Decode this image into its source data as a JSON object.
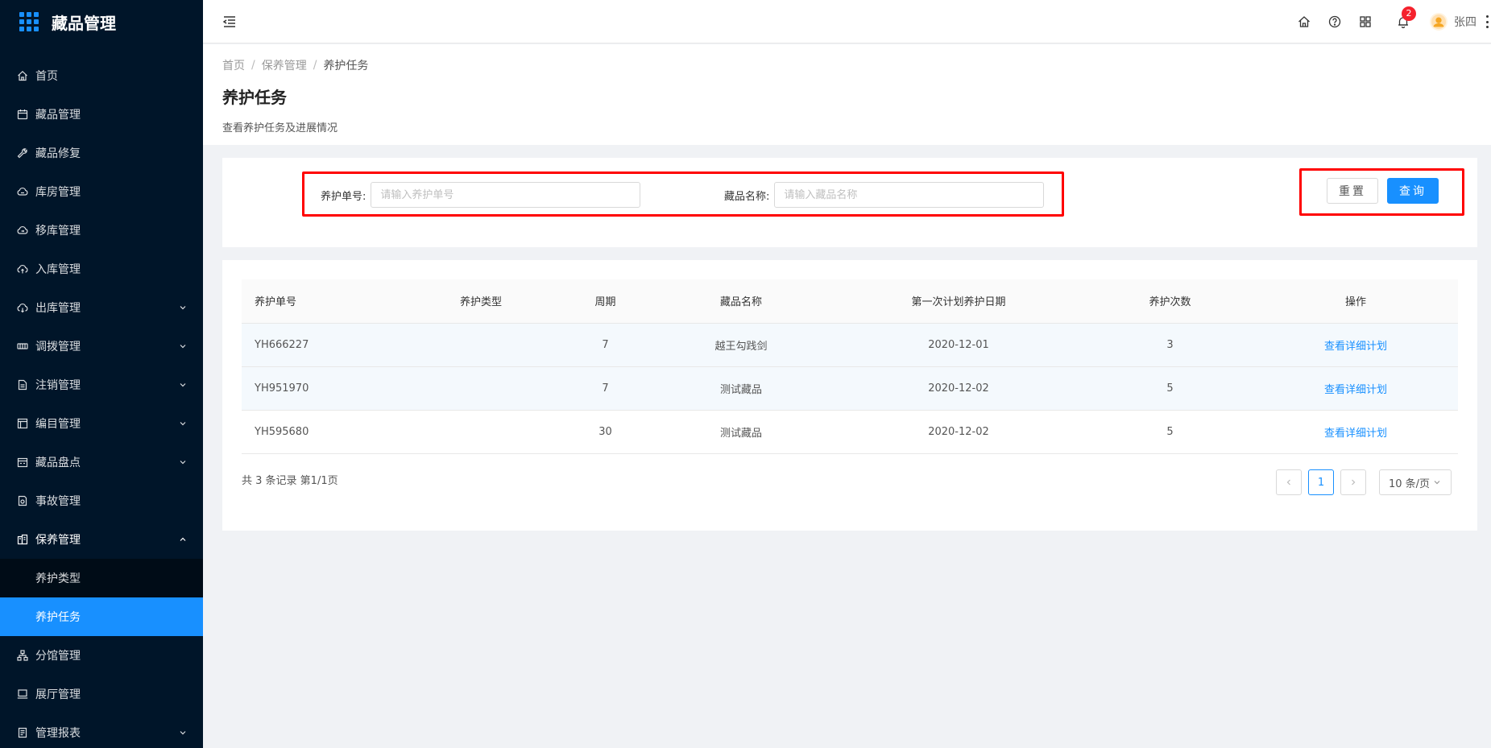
{
  "app": {
    "title": "藏品管理"
  },
  "sidebar": {
    "items": [
      {
        "label": "首页",
        "icon": "home-icon"
      },
      {
        "label": "藏品管理",
        "icon": "calendar-icon"
      },
      {
        "label": "藏品修复",
        "icon": "wrench-icon"
      },
      {
        "label": "库房管理",
        "icon": "cloud-icon"
      },
      {
        "label": "移库管理",
        "icon": "cloud-sync-icon"
      },
      {
        "label": "入库管理",
        "icon": "cloud-upload-icon"
      },
      {
        "label": "出库管理",
        "icon": "cloud-download-icon",
        "expandable": true
      },
      {
        "label": "调拨管理",
        "icon": "transfer-icon",
        "expandable": true
      },
      {
        "label": "注销管理",
        "icon": "file-icon",
        "expandable": true
      },
      {
        "label": "编目管理",
        "icon": "catalog-icon",
        "expandable": true
      },
      {
        "label": "藏品盘点",
        "icon": "inventory-icon",
        "expandable": true
      },
      {
        "label": "事故管理",
        "icon": "accident-icon"
      },
      {
        "label": "保养管理",
        "icon": "maintenance-icon",
        "expanded": true
      },
      {
        "label": "分馆管理",
        "icon": "branch-icon"
      },
      {
        "label": "展厅管理",
        "icon": "monitor-icon"
      },
      {
        "label": "管理报表",
        "icon": "report-icon",
        "expandable": true
      }
    ],
    "submenu": [
      {
        "label": "养护类型"
      },
      {
        "label": "养护任务",
        "active": true
      }
    ]
  },
  "header": {
    "notification_count": "2",
    "username": "张四"
  },
  "breadcrumb": [
    "首页",
    "保养管理",
    "养护任务"
  ],
  "page": {
    "title": "养护任务",
    "description": "查看养护任务及进展情况"
  },
  "search": {
    "order_label": "养护单号:",
    "order_placeholder": "请输入养护单号",
    "name_label": "藏品名称:",
    "name_placeholder": "请输入藏品名称",
    "reset_label": "重置",
    "query_label": "查询"
  },
  "table": {
    "columns": [
      "养护单号",
      "养护类型",
      "周期",
      "藏品名称",
      "第一次计划养护日期",
      "养护次数",
      "操作"
    ],
    "rows": [
      {
        "order": "YH666227",
        "type": "",
        "period": "7",
        "name": "越王勾践剑",
        "date": "2020-12-01",
        "count": "3",
        "action": "查看详细计划"
      },
      {
        "order": "YH951970",
        "type": "",
        "period": "7",
        "name": "测试藏品",
        "date": "2020-12-02",
        "count": "5",
        "action": "查看详细计划"
      },
      {
        "order": "YH595680",
        "type": "",
        "period": "30",
        "name": "测试藏品",
        "date": "2020-12-02",
        "count": "5",
        "action": "查看详细计划"
      }
    ]
  },
  "pagination": {
    "summary": "共 3 条记录 第1/1页",
    "current_page": "1",
    "page_size": "10 条/页"
  },
  "colors": {
    "sidebar_bg": "#001529",
    "primary": "#1890ff",
    "highlight_border": "#ff0000",
    "badge": "#f5222d"
  }
}
